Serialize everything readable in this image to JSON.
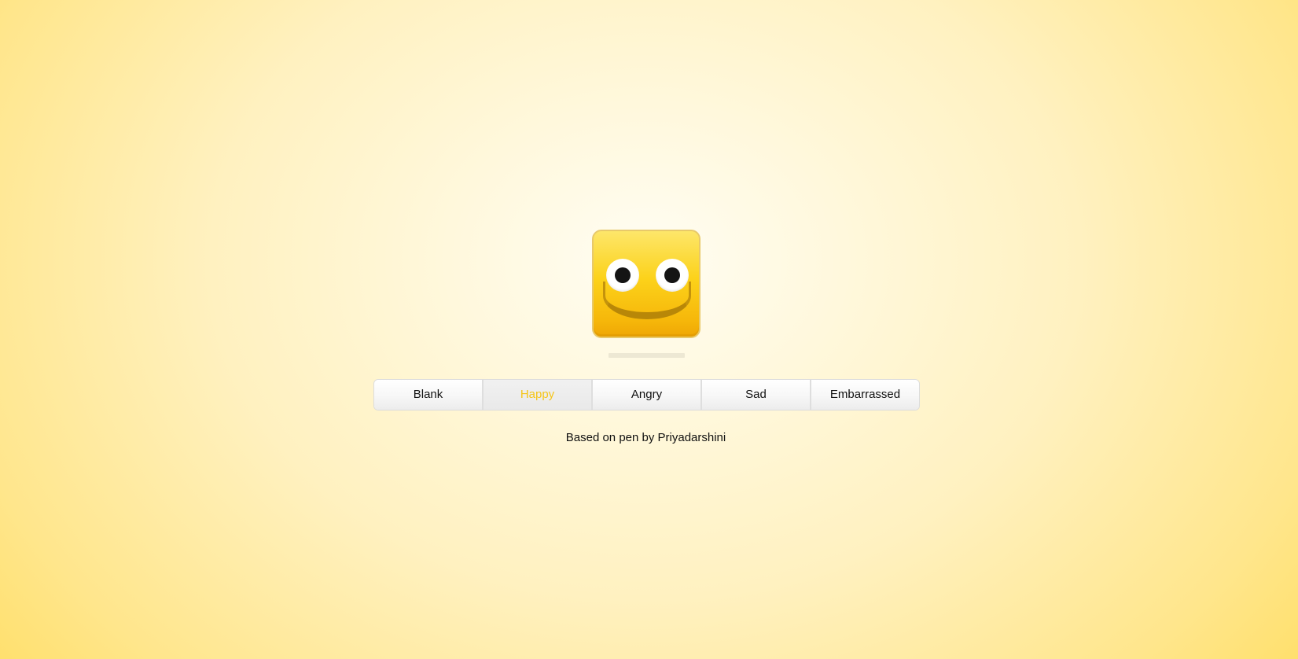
{
  "face": {
    "current_expression": "Happy",
    "colors": {
      "face_top": "#fde66a",
      "face_bottom": "#efa604",
      "mouth": "#b88708",
      "pupil": "#141414"
    }
  },
  "buttons": [
    {
      "label": "Blank",
      "active": false
    },
    {
      "label": "Happy",
      "active": true
    },
    {
      "label": "Angry",
      "active": false
    },
    {
      "label": "Sad",
      "active": false
    },
    {
      "label": "Embarrassed",
      "active": false
    }
  ],
  "active_color": "#f5c518",
  "credit": "Based on pen by Priyadarshini"
}
